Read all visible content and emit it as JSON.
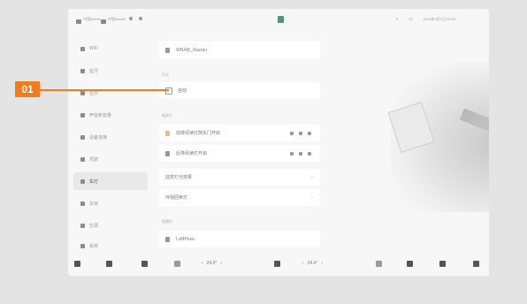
{
  "status_bar": {
    "left_1": "中国Mobile",
    "left_2": "中国Mobile",
    "icon_a": "bluetooth-icon",
    "icon_b": "wifi-icon",
    "center_icon": "app-green-icon",
    "right_1": "0",
    "right_2": "22",
    "right_time": "2023年4月1日 09:15"
  },
  "sidebar": {
    "items": [
      {
        "label": "WiFi",
        "icon": "wifi-icon"
      },
      {
        "label": "蓝牙",
        "icon": "bluetooth-icon"
      },
      {
        "label": "显示",
        "icon": "display-icon"
      },
      {
        "label": "声音和音量",
        "icon": "sound-icon"
      },
      {
        "label": "设备连接",
        "icon": "device-icon"
      },
      {
        "label": "驾驶",
        "icon": "drive-icon"
      },
      {
        "label": "车灯",
        "icon": "light-icon",
        "active": true
      },
      {
        "label": "车锁",
        "icon": "lock-icon"
      },
      {
        "label": "空调",
        "icon": "ac-icon"
      },
      {
        "label": "系统",
        "icon": "system-icon"
      }
    ]
  },
  "panel": {
    "row1_label": "WNXM_Xiaoxiu",
    "section1": "灯光",
    "checkbox_label": "自动",
    "section2": "阅读灯",
    "row3_label": "前排阅读灯随车门开启",
    "row4_label": "后排阅读灯开启",
    "row5_label": "迎宾灯光效果",
    "row6_label": "伴我回家灯",
    "section3": "氛围灯",
    "row7_label": "LxMPoxo"
  },
  "callout": {
    "badge": "01",
    "color": "#f07c1c"
  },
  "bottom_bar": {
    "temp_left": "24.0°",
    "temp_right": "24.0°"
  }
}
